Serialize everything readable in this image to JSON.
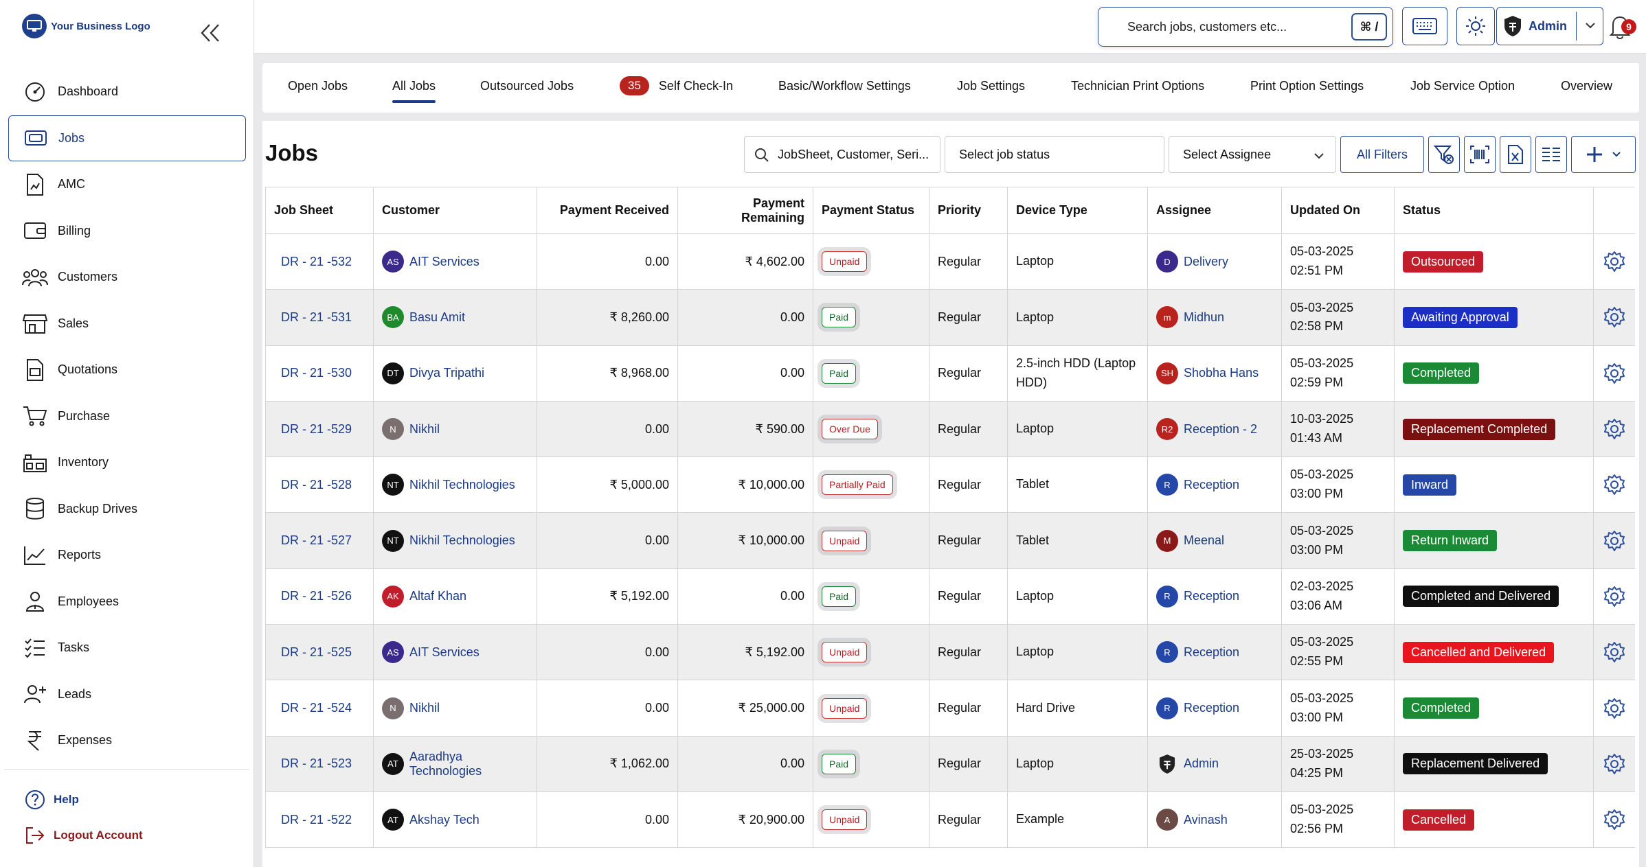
{
  "sidebar": {
    "logo_text": "Your Business Logo",
    "items": [
      {
        "label": "Dashboard"
      },
      {
        "label": "Jobs"
      },
      {
        "label": "AMC"
      },
      {
        "label": "Billing"
      },
      {
        "label": "Customers"
      },
      {
        "label": "Sales"
      },
      {
        "label": "Quotations"
      },
      {
        "label": "Purchase"
      },
      {
        "label": "Inventory"
      },
      {
        "label": "Backup Drives"
      },
      {
        "label": "Reports"
      },
      {
        "label": "Employees"
      },
      {
        "label": "Tasks"
      },
      {
        "label": "Leads"
      },
      {
        "label": "Expenses"
      }
    ],
    "help_label": "Help",
    "logout_label": "Logout Account"
  },
  "topbar": {
    "search_placeholder": "Search jobs, customers etc...",
    "shortcut": "⌘ /",
    "admin_label": "Admin",
    "notification_count": "9"
  },
  "tabs": [
    {
      "label": "Open Jobs"
    },
    {
      "label": "All Jobs"
    },
    {
      "label": "Outsourced Jobs"
    },
    {
      "label": "Self Check-In",
      "badge": "35"
    },
    {
      "label": "Basic/Workflow Settings"
    },
    {
      "label": "Job Settings"
    },
    {
      "label": "Technician Print Options"
    },
    {
      "label": "Print Option Settings"
    },
    {
      "label": "Job Service Option"
    },
    {
      "label": "Overview"
    }
  ],
  "main": {
    "title": "Jobs",
    "search_placeholder": "JobSheet, Customer, Seri...",
    "job_status_placeholder": "Select job status",
    "assignee_placeholder": "Select Assignee",
    "all_filters_label": "All Filters"
  },
  "table": {
    "columns": [
      "Job Sheet",
      "Customer",
      "Payment Received",
      "Payment Remaining",
      "Payment Status",
      "Priority",
      "Device Type",
      "Assignee",
      "Updated On",
      "Status"
    ],
    "rows": [
      {
        "job": "DR - 21 -532",
        "cust_init": "AS",
        "cust_color": "#3b2a8c",
        "customer": "AIT Services",
        "received": "0.00",
        "remaining": "₹ 4,602.00",
        "pay": "Unpaid",
        "pay_cls": "unpaid",
        "priority": "Regular",
        "device": "Laptop",
        "as_init": "D",
        "as_color": "#3b2a8c",
        "assignee": "Delivery",
        "date": "05-03-2025",
        "time": "02:51 PM",
        "status": "Outsourced",
        "status_color": "#c21d2a"
      },
      {
        "job": "DR - 21 -531",
        "cust_init": "BA",
        "cust_color": "#1e8a2c",
        "customer": "Basu Amit",
        "received": "₹ 8,260.00",
        "remaining": "0.00",
        "pay": "Paid",
        "pay_cls": "paid",
        "priority": "Regular",
        "device": "Laptop",
        "as_init": "m",
        "as_color": "#b8231e",
        "assignee": "Midhun",
        "date": "05-03-2025",
        "time": "02:58 PM",
        "status": "Awaiting Approval",
        "status_color": "#1c2fc4"
      },
      {
        "job": "DR - 21 -530",
        "cust_init": "DT",
        "cust_color": "#111111",
        "customer": "Divya Tripathi",
        "received": "₹ 8,968.00",
        "remaining": "0.00",
        "pay": "Paid",
        "pay_cls": "paid",
        "priority": "Regular",
        "device": "2.5-inch HDD (Laptop HDD)",
        "as_init": "SH",
        "as_color": "#b8231e",
        "assignee": "Shobha Hans",
        "date": "05-03-2025",
        "time": "02:59 PM",
        "status": "Completed",
        "status_color": "#1a8a35"
      },
      {
        "job": "DR - 21 -529",
        "cust_init": "N",
        "cust_color": "#7a6e6e",
        "customer": "Nikhil",
        "received": "0.00",
        "remaining": "₹ 590.00",
        "pay": "Over Due",
        "pay_cls": "over",
        "priority": "Regular",
        "device": "Laptop",
        "as_init": "R2",
        "as_color": "#b8231e",
        "assignee": "Reception - 2",
        "date": "10-03-2025",
        "time": "01:43 AM",
        "status": "Replacement Completed",
        "status_color": "#7a1010"
      },
      {
        "job": "DR - 21 -528",
        "cust_init": "NT",
        "cust_color": "#111111",
        "customer": "Nikhil Technologies",
        "received": "₹ 5,000.00",
        "remaining": "₹ 10,000.00",
        "pay": "Partially Paid",
        "pay_cls": "partial",
        "priority": "Regular",
        "device": "Tablet",
        "as_init": "R",
        "as_color": "#2548a8",
        "assignee": "Reception",
        "date": "05-03-2025",
        "time": "03:00 PM",
        "status": "Inward",
        "status_color": "#2548a8"
      },
      {
        "job": "DR - 21 -527",
        "cust_init": "NT",
        "cust_color": "#111111",
        "customer": "Nikhil Technologies",
        "received": "0.00",
        "remaining": "₹ 10,000.00",
        "pay": "Unpaid",
        "pay_cls": "unpaid",
        "priority": "Regular",
        "device": "Tablet",
        "as_init": "M",
        "as_color": "#8a1a1a",
        "assignee": "Meenal",
        "date": "05-03-2025",
        "time": "03:00 PM",
        "status": "Return Inward",
        "status_color": "#1a8a35"
      },
      {
        "job": "DR - 21 -526",
        "cust_init": "AK",
        "cust_color": "#c21d2a",
        "customer": "Altaf Khan",
        "received": "₹ 5,192.00",
        "remaining": "0.00",
        "pay": "Paid",
        "pay_cls": "paid",
        "priority": "Regular",
        "device": "Laptop",
        "as_init": "R",
        "as_color": "#2548a8",
        "assignee": "Reception",
        "date": "02-03-2025",
        "time": "03:06 AM",
        "status": "Completed and Delivered",
        "status_color": "#0f0f0f"
      },
      {
        "job": "DR - 21 -525",
        "cust_init": "AS",
        "cust_color": "#3b2a8c",
        "customer": "AIT Services",
        "received": "0.00",
        "remaining": "₹ 5,192.00",
        "pay": "Unpaid",
        "pay_cls": "unpaid",
        "priority": "Regular",
        "device": "Laptop",
        "as_init": "R",
        "as_color": "#2548a8",
        "assignee": "Reception",
        "date": "05-03-2025",
        "time": "02:55 PM",
        "status": "Cancelled and Delivered",
        "status_color": "#e8141e"
      },
      {
        "job": "DR - 21 -524",
        "cust_init": "N",
        "cust_color": "#7a6e6e",
        "customer": "Nikhil",
        "received": "0.00",
        "remaining": "₹ 25,000.00",
        "pay": "Unpaid",
        "pay_cls": "unpaid",
        "priority": "Regular",
        "device": "Hard Drive",
        "as_init": "R",
        "as_color": "#2548a8",
        "assignee": "Reception",
        "date": "05-03-2025",
        "time": "03:00 PM",
        "status": "Completed",
        "status_color": "#1a8a35"
      },
      {
        "job": "DR - 21 -523",
        "cust_init": "AT",
        "cust_color": "#111111",
        "customer": "Aaradhya Technologies",
        "received": "₹ 1,062.00",
        "remaining": "0.00",
        "pay": "Paid",
        "pay_cls": "paid",
        "priority": "Regular",
        "device": "Laptop",
        "as_init": "",
        "as_color": "#ffffff",
        "assignee": "Admin",
        "date": "25-03-2025",
        "time": "04:25 PM",
        "status": "Replacement Delivered",
        "status_color": "#0f0f0f"
      },
      {
        "job": "DR - 21 -522",
        "cust_init": "AT",
        "cust_color": "#111111",
        "customer": "Akshay Tech",
        "received": "0.00",
        "remaining": "₹ 20,900.00",
        "pay": "Unpaid",
        "pay_cls": "unpaid",
        "priority": "Regular",
        "device": "Example",
        "as_init": "A",
        "as_color": "#6b4a45",
        "assignee": "Avinash",
        "date": "05-03-2025",
        "time": "02:56 PM",
        "status": "Cancelled",
        "status_color": "#c21d2a"
      }
    ]
  }
}
